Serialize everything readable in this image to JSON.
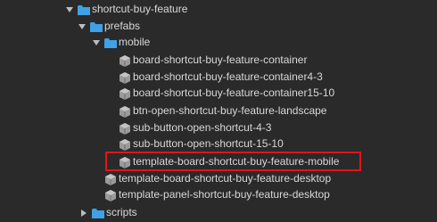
{
  "tree": {
    "rows": [
      {
        "label": "shortcut-buy-feature",
        "kind": "folder",
        "expanded": true
      },
      {
        "label": "prefabs",
        "kind": "folder",
        "expanded": true
      },
      {
        "label": "mobile",
        "kind": "folder",
        "expanded": true
      },
      {
        "label": "board-shortcut-buy-feature-container",
        "kind": "prefab"
      },
      {
        "label": "board-shortcut-buy-feature-container4-3",
        "kind": "prefab"
      },
      {
        "label": "board-shortcut-buy-feature-container15-10",
        "kind": "prefab"
      },
      {
        "label": "btn-open-shortcut-buy-feature-landscape",
        "kind": "prefab"
      },
      {
        "label": "sub-button-open-shortcut-4-3",
        "kind": "prefab"
      },
      {
        "label": "sub-button-open-shortcut-15-10",
        "kind": "prefab"
      },
      {
        "label": "template-board-shortcut-buy-feature-mobile",
        "kind": "prefab",
        "highlighted": true
      },
      {
        "label": "template-board-shortcut-buy-feature-desktop",
        "kind": "prefab"
      },
      {
        "label": "template-panel-shortcut-buy-feature-desktop",
        "kind": "prefab"
      },
      {
        "label": "scripts",
        "kind": "folder",
        "expanded": false
      }
    ]
  },
  "colors": {
    "background": "#2a2a2a",
    "text": "#d8d8d8",
    "folder": "#3fa1e6",
    "prefab": "#9a9a9a",
    "highlight": "#e0151b"
  }
}
